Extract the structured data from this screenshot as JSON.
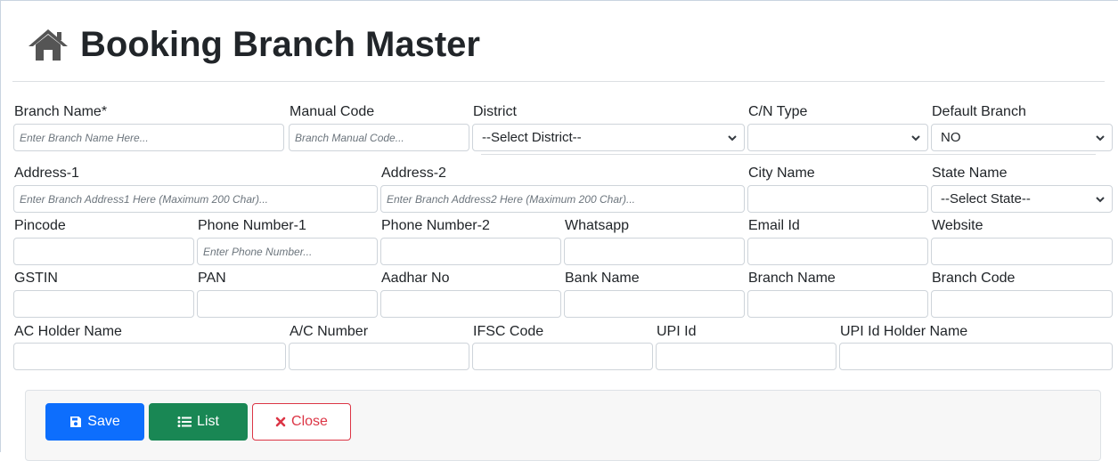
{
  "page": {
    "title": "Booking Branch Master",
    "title_icon": "home-icon"
  },
  "row1": {
    "branch_name": {
      "label": "Branch Name*",
      "placeholder": "Enter Branch Name Here..."
    },
    "manual_code": {
      "label": "Manual Code",
      "placeholder": "Branch Manual Code..."
    },
    "district": {
      "label": "District",
      "value": "--Select District--"
    },
    "cn_type": {
      "label": "C/N Type",
      "value": ""
    },
    "default_branch": {
      "label": "Default Branch",
      "value": "NO"
    }
  },
  "row2": {
    "address1": {
      "label": "Address-1",
      "placeholder": "Enter Branch Address1 Here (Maximum 200 Char)..."
    },
    "address2": {
      "label": "Address-2",
      "placeholder": "Enter Branch Address2 Here (Maximum 200 Char)..."
    },
    "city_name": {
      "label": "City Name",
      "value": ""
    },
    "state_name": {
      "label": "State Name",
      "value": "--Select State--"
    }
  },
  "row3": {
    "pincode": {
      "label": "Pincode",
      "value": ""
    },
    "phone1": {
      "label": "Phone Number-1",
      "placeholder": "Enter Phone Number..."
    },
    "phone2": {
      "label": "Phone Number-2",
      "value": ""
    },
    "whatsapp": {
      "label": "Whatsapp",
      "value": ""
    },
    "email": {
      "label": "Email Id",
      "value": ""
    },
    "website": {
      "label": "Website",
      "value": ""
    }
  },
  "row4": {
    "gstin": {
      "label": "GSTIN",
      "value": ""
    },
    "pan": {
      "label": "PAN",
      "value": ""
    },
    "aadhar": {
      "label": "Aadhar No",
      "value": ""
    },
    "bank_name": {
      "label": "Bank Name",
      "value": ""
    },
    "bank_branch_name": {
      "label": "Branch Name",
      "value": ""
    },
    "branch_code": {
      "label": "Branch Code",
      "value": ""
    }
  },
  "row5": {
    "ac_holder_name": {
      "label": "AC Holder Name",
      "value": ""
    },
    "ac_number": {
      "label": "A/C Number",
      "value": ""
    },
    "ifsc_code": {
      "label": "IFSC Code",
      "value": ""
    },
    "upi_id": {
      "label": "UPI Id",
      "value": ""
    },
    "upi_holder_name": {
      "label": "UPI Id Holder Name",
      "value": ""
    }
  },
  "actions": {
    "save_label": "Save",
    "save_icon": "floppy-disk-icon",
    "list_label": "List",
    "list_icon": "list-icon",
    "close_label": "Close",
    "close_icon": "x-icon"
  },
  "colors": {
    "primary": "#0d6efd",
    "success": "#198754",
    "danger": "#dc3545"
  }
}
